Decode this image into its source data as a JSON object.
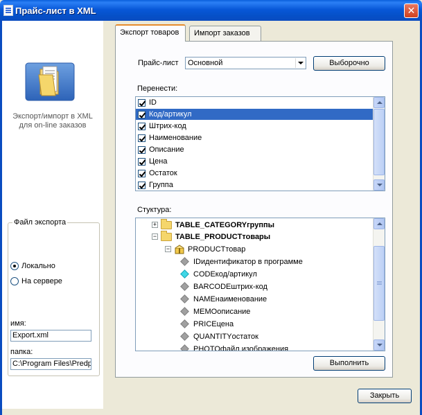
{
  "window": {
    "title": "Прайс-лист в XML",
    "close_label": "✕"
  },
  "sidebar": {
    "caption_line1": "Экспорт/импорт в XML",
    "caption_line2": "для on-line заказов",
    "export_group": {
      "legend": "Файл экспорта",
      "options": [
        {
          "label": "Локально",
          "checked": true
        },
        {
          "label": "На сервере",
          "checked": false
        }
      ],
      "name_label": "имя:",
      "name_value": "Export.xml",
      "folder_label": "папка:",
      "folder_value": "C:\\Program Files\\Predpr"
    }
  },
  "tabs": [
    {
      "label": "Экспорт товаров",
      "active": true
    },
    {
      "label": "Импорт заказов",
      "active": false
    }
  ],
  "export": {
    "pricelist_label": "Прайс-лист",
    "pricelist_value": "Основной",
    "selective_button": "Выборочно",
    "transfer_label": "Перенести:",
    "fields": [
      {
        "label": "ID",
        "checked": true,
        "selected": false
      },
      {
        "label": "Код/артикул",
        "checked": true,
        "selected": true
      },
      {
        "label": "Штрих-код",
        "checked": true,
        "selected": false
      },
      {
        "label": "Наименование",
        "checked": true,
        "selected": false
      },
      {
        "label": "Описание",
        "checked": true,
        "selected": false
      },
      {
        "label": "Цена",
        "checked": true,
        "selected": false
      },
      {
        "label": "Остаток",
        "checked": true,
        "selected": false
      },
      {
        "label": "Группа",
        "checked": true,
        "selected": false
      }
    ],
    "structure_label": "Стуктура:",
    "tree": [
      {
        "name": "TABLE_CATEGORY",
        "desc": " группы",
        "level": 0,
        "type": "folder",
        "expander": "+"
      },
      {
        "name": "TABLE_PRODUCT",
        "desc": " товары",
        "level": 0,
        "type": "folder",
        "expander": "−"
      },
      {
        "name": "PRODUCT",
        "desc": " товар",
        "level": 1,
        "type": "package",
        "expander": "−"
      },
      {
        "name": "ID",
        "desc": " идентификатор в программе",
        "level": 2,
        "type": "field"
      },
      {
        "name": "CODE",
        "desc": " код/артикул",
        "level": 2,
        "type": "field-key"
      },
      {
        "name": "BARCODE",
        "desc": " штрих-код",
        "level": 2,
        "type": "field"
      },
      {
        "name": "NAME",
        "desc": " наименование",
        "level": 2,
        "type": "field"
      },
      {
        "name": "MEMO",
        "desc": " описание",
        "level": 2,
        "type": "field"
      },
      {
        "name": "PRICE",
        "desc": " цена",
        "level": 2,
        "type": "field"
      },
      {
        "name": "QUANTITY",
        "desc": " остаток",
        "level": 2,
        "type": "field"
      },
      {
        "name": "PHOTO",
        "desc": " файл изображения",
        "level": 2,
        "type": "field"
      }
    ],
    "run_button": "Выполнить"
  },
  "footer": {
    "close_button": "Закрыть"
  },
  "colors": {
    "titlebar": "#0858d8",
    "selection": "#316ac5",
    "tab_accent": "#e68b2c",
    "key_field": "#3fd7e6"
  }
}
